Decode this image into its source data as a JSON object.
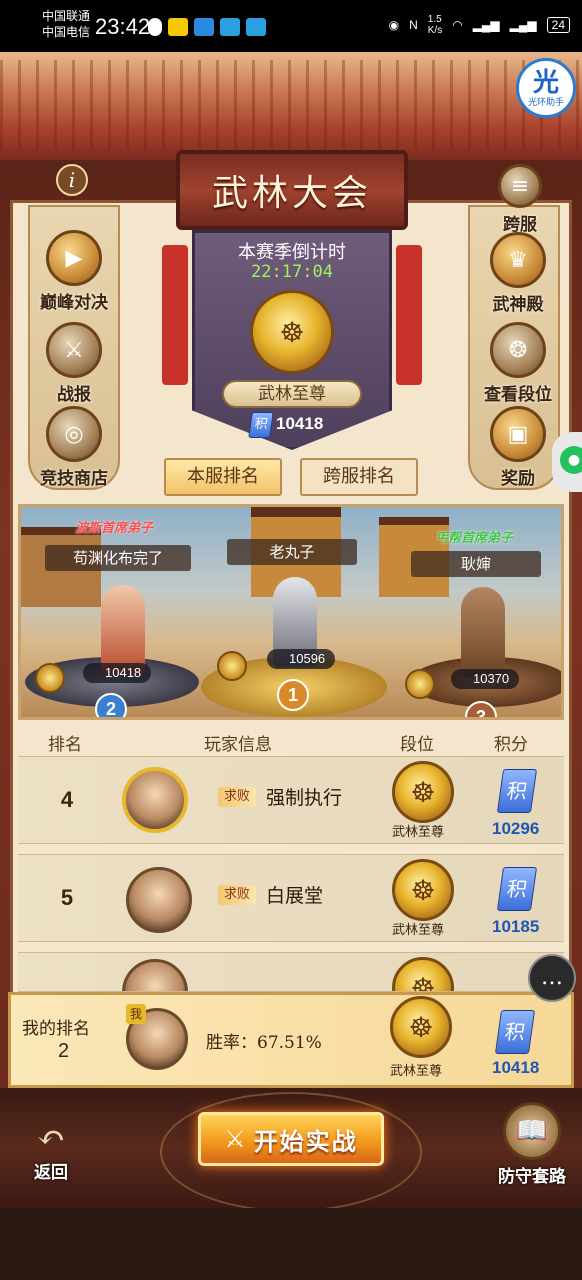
{
  "status_bar": {
    "carrier1": "中国联通",
    "carrier2": "中国电信",
    "time": "23:42",
    "speed": "1.5\nK/s",
    "battery": "24"
  },
  "helper": {
    "glyph": "光",
    "label": "光环助手"
  },
  "title": "武林大会",
  "season": {
    "label": "本赛季倒计时",
    "countdown": "22:17:04",
    "rank_title": "武林至尊",
    "score": "10418"
  },
  "left_menu": [
    {
      "label": "巅峰对决",
      "icon": "play-icon"
    },
    {
      "label": "战报",
      "icon": "battle-report-icon"
    },
    {
      "label": "竞技商店",
      "icon": "shop-icon"
    }
  ],
  "right_menu": [
    {
      "label": "跨服",
      "icon": "list-icon"
    },
    {
      "label": "武神殿",
      "icon": "temple-icon"
    },
    {
      "label": "查看段位",
      "icon": "rank-crest-icon"
    },
    {
      "label": "奖励",
      "icon": "chest-icon"
    }
  ],
  "tabs": [
    {
      "label": "本服排名",
      "active": true
    },
    {
      "label": "跨服排名",
      "active": false
    }
  ],
  "podium": [
    {
      "place": "1",
      "name": "老丸子",
      "score": "10596",
      "title": ""
    },
    {
      "place": "2",
      "name": "苟渊化布完了",
      "score": "10418",
      "title": "波斯首席弟子"
    },
    {
      "place": "3",
      "name": "耿婶",
      "score": "10370",
      "title": "丐帮首席弟子"
    }
  ],
  "table_header": {
    "rank": "排名",
    "player": "玩家信息",
    "dan": "段位",
    "score": "积分"
  },
  "rows": [
    {
      "rank": "4",
      "tag": "求败",
      "name": "强制执行",
      "dan": "武林至尊",
      "score": "10296"
    },
    {
      "rank": "5",
      "tag": "求败",
      "name": "白展堂",
      "dan": "武林至尊",
      "score": "10185"
    }
  ],
  "ji_glyph": "积",
  "my_rank": {
    "label": "我的排名",
    "rank": "2",
    "me_tag": "我",
    "win_rate": "胜率：67.51%",
    "dan": "武林至尊",
    "score": "10418"
  },
  "bottom": {
    "back": "返回",
    "start": "开始实战",
    "defense": "防守套路"
  },
  "colors": {
    "accent": "#f39a1c",
    "score_blue": "#1f58b4",
    "timer_green": "#9cf560"
  }
}
